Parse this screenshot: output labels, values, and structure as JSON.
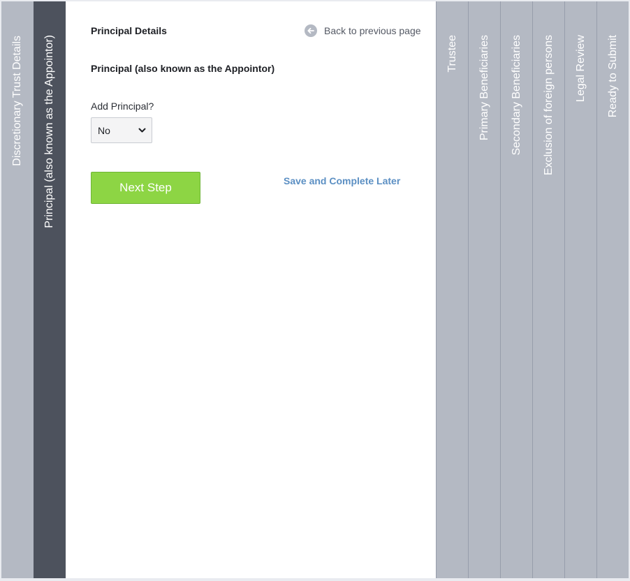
{
  "left_tabs": [
    {
      "label": "Discretionary Trust Details"
    },
    {
      "label": "Principal (also known as the Appointor)"
    }
  ],
  "main": {
    "heading": "Principal Details",
    "back_link": "Back to previous page",
    "subheading": "Principal (also known as the Appointor)",
    "add_principal": {
      "label": "Add Principal?",
      "selected": "No"
    },
    "next_button": "Next Step",
    "save_link": "Save and Complete Later"
  },
  "right_tabs": [
    {
      "label": "Trustee"
    },
    {
      "label": "Primary Beneficiaries"
    },
    {
      "label": "Secondary Beneficiaries"
    },
    {
      "label": "Exclusion of foreign persons"
    },
    {
      "label": "Legal Review"
    },
    {
      "label": "Ready to Submit"
    }
  ],
  "colors": {
    "tab_inactive": "#b4b9c3",
    "tab_active": "#4d525d",
    "button_green": "#8dd544",
    "link_blue": "#5b8fc3"
  }
}
